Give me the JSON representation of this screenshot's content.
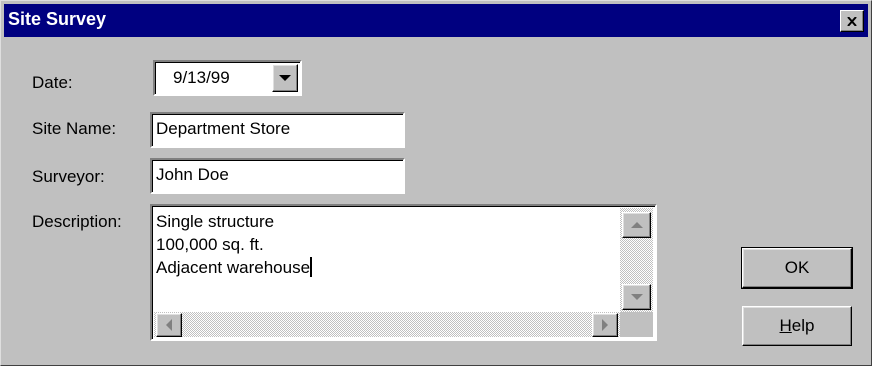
{
  "window": {
    "title": "Site Survey",
    "close_glyph": "✕"
  },
  "form": {
    "date": {
      "label": "Date:",
      "value": "9/13/99"
    },
    "site_name": {
      "label": "Site Name:",
      "value": "Department Store"
    },
    "surveyor": {
      "label": "Surveyor:",
      "value": "John Doe"
    },
    "description": {
      "label": "Description:",
      "lines": [
        "Single structure",
        "100,000 sq. ft.",
        "Adjacent warehouse"
      ]
    }
  },
  "buttons": {
    "ok": "OK",
    "help_prefix": "H",
    "help_rest": "elp"
  },
  "icons": [
    "close-icon",
    "dropdown-arrow-icon",
    "scroll-up-icon",
    "scroll-down-icon",
    "scroll-left-icon",
    "scroll-right-icon"
  ]
}
